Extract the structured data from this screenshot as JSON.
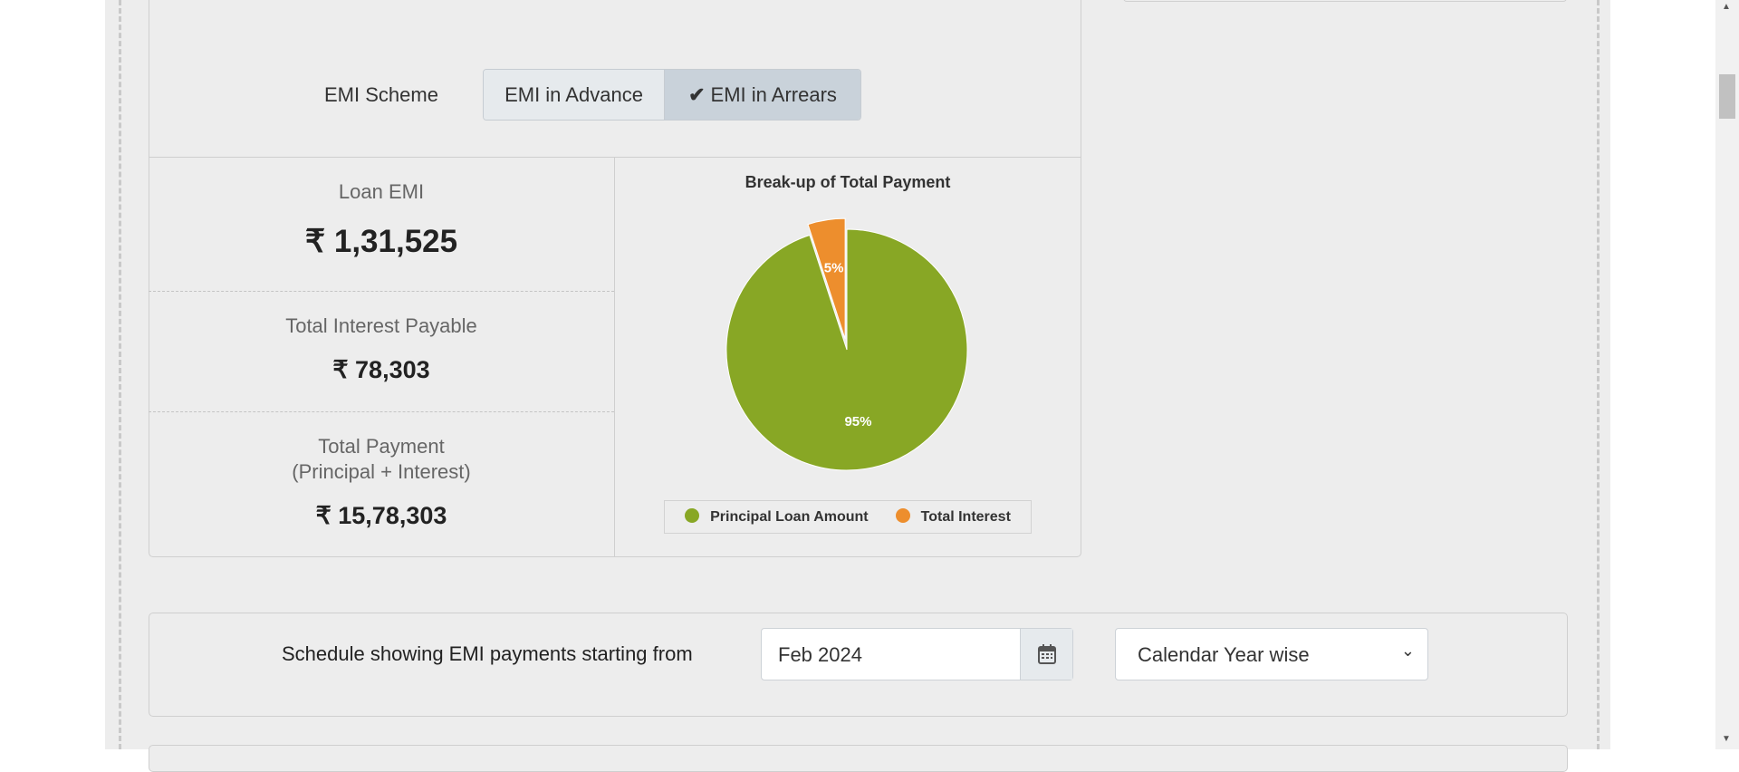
{
  "emi_scheme": {
    "label": "EMI Scheme",
    "options": [
      "EMI in Advance",
      "EMI in Arrears"
    ],
    "selected": "EMI in Arrears"
  },
  "results": {
    "loan_emi": {
      "label": "Loan EMI",
      "value": "₹ 1,31,525"
    },
    "total_interest": {
      "label": "Total Interest Payable",
      "value": "₹ 78,303"
    },
    "total_payment": {
      "label": "Total Payment",
      "sublabel": "(Principal + Interest)",
      "value": "₹ 15,78,303"
    }
  },
  "chart_data": {
    "type": "pie",
    "title": "Break-up of Total Payment",
    "categories": [
      "Principal Loan Amount",
      "Total Interest"
    ],
    "values": [
      95,
      5
    ],
    "labels": [
      "95%",
      "5%"
    ],
    "colors": [
      "#88a725",
      "#ed8e2d"
    ],
    "legend": "bottom"
  },
  "schedule": {
    "label": "Schedule showing EMI payments starting from",
    "start": "Feb 2024",
    "view": "Calendar Year wise"
  }
}
